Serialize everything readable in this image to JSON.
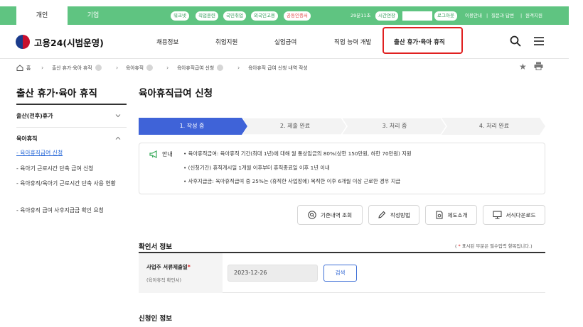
{
  "topbar": {
    "tabs": [
      "개인",
      "기업"
    ],
    "chips": [
      "워크넷",
      "직업훈련",
      "국민취업",
      "외국인고용",
      "공동인증서"
    ],
    "session_time": "29분11초",
    "extend_label": "시간연장",
    "logout_label": "로그아웃",
    "utils": [
      "이용안내",
      "질문과 답변",
      "원격지원"
    ],
    "util_separator": "|"
  },
  "header": {
    "logo_text": "고용24(시범운영)",
    "nav": [
      "채용정보",
      "취업지원",
      "실업급여",
      "직업 능력 개발",
      "출산 휴가·육아 휴직"
    ]
  },
  "breadcrumb": {
    "items": [
      "홈",
      "출산 휴가·육아 휴직",
      "육아휴직",
      "육아휴직급여 신청",
      "육아휴직 급여 신청 내역 작성"
    ]
  },
  "sidebar": {
    "title": "출산 휴가·육아 휴직",
    "group1": "출산(전후)휴가",
    "group2": "육아휴직",
    "subitems": [
      "- 육아휴직급여 신청",
      "- 육아기 근로시간 단축 급여 신청",
      "- 육아휴직/육아기 근로시간 단축 사용 현황",
      "- 육아휴직 급여 사후지급금 확인 요청"
    ]
  },
  "main": {
    "title": "육아휴직급여 신청",
    "steps": [
      "1. 작성 중",
      "2. 제출 완료",
      "3. 처리 중",
      "4. 처리 완료"
    ],
    "info_label": "안내",
    "info_lines": [
      "• 육아휴직급여: 육아휴직 기간(최대 1년)에 대해 월 통상임금의 80%(상한 150만원, 하한 70만원) 지원",
      "• (신청기간) 휴직개시일 1개월 이후부터 휴직종료일 이후 1년 이내",
      "• 사후지급금: 육아휴직급여 중 25%는 (휴직한 사업장에) 복직한 이후 6개월 이상 근로한 경우 지급"
    ],
    "action_buttons": [
      "기존내역 조회",
      "작성방법",
      "제도소개",
      "서식다운로드"
    ],
    "section1_title": "확인서 정보",
    "required_note_open": "( ",
    "required_note_star": "*",
    "required_note_text": " 표시된 부분은 필수입력 항목입니다.)",
    "form_label": "사업주 서류제출일",
    "form_label_star": "*",
    "form_sub": "(육아휴직 확인서)",
    "form_value": "2023-12-26",
    "form_button": "검색",
    "section2_title": "신청인 정보"
  },
  "colors": {
    "topbar_green": "#5fc481",
    "active_step": "#3f63d8",
    "highlight_red": "#e02020"
  }
}
